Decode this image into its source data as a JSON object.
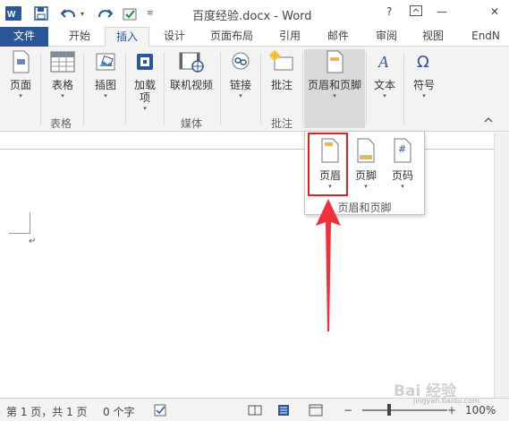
{
  "window": {
    "title": "百度经验.docx - Word",
    "help": "?",
    "minimize": "—",
    "close": "✕"
  },
  "tabs": [
    {
      "label": "文件"
    },
    {
      "label": "开始"
    },
    {
      "label": "插入"
    },
    {
      "label": "设计"
    },
    {
      "label": "页面布局"
    },
    {
      "label": "引用"
    },
    {
      "label": "邮件"
    },
    {
      "label": "审阅"
    },
    {
      "label": "视图"
    },
    {
      "label": "EndN"
    }
  ],
  "ribbon": {
    "buttons": {
      "page": "页面",
      "table": "表格",
      "illustrations": "插图",
      "addins": "加载\n项",
      "online_video": "联机视频",
      "links": "链接",
      "comment": "批注",
      "header_footer": "页眉和页脚",
      "text": "文本",
      "symbols": "符号"
    },
    "groups": {
      "tables": "表格",
      "media": "媒体",
      "comments": "批注"
    },
    "dropdown_arrow": "▾"
  },
  "dropdown": {
    "items": [
      {
        "label": "页眉"
      },
      {
        "label": "页脚"
      },
      {
        "label": "页码"
      }
    ],
    "caption": "页眉和页脚"
  },
  "document": {
    "paragraph_mark": "↵"
  },
  "status": {
    "pages": "第 1 页，共 1 页",
    "words": "0 个字",
    "zoom": "100%",
    "zoom_fraction": 0.32
  },
  "watermark": {
    "text": "Bai 经验",
    "url": "jingyan.baidu.com"
  },
  "colors": {
    "accent": "#2b579a",
    "highlight": "#e02020"
  }
}
